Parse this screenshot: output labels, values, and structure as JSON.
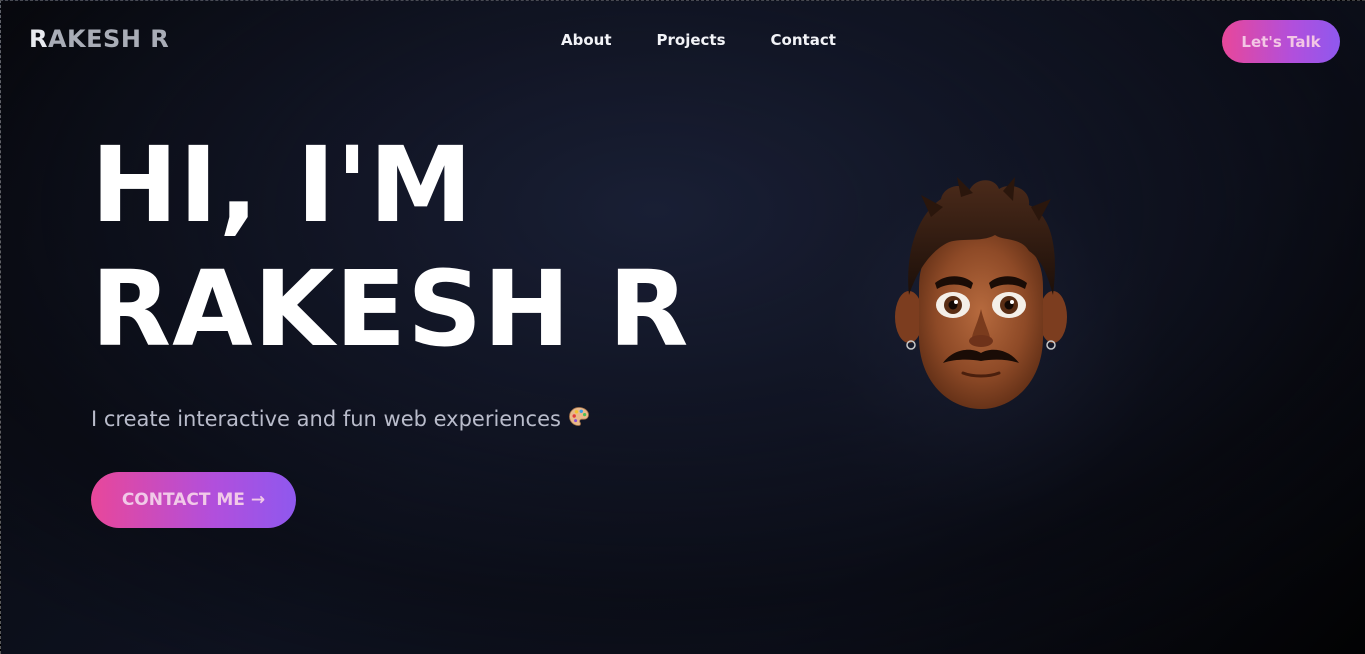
{
  "nav": {
    "brand_first": "R",
    "brand_rest": "AKESH R",
    "links": [
      {
        "label": "About"
      },
      {
        "label": "Projects"
      },
      {
        "label": "Contact"
      }
    ],
    "cta_label": "Let's Talk"
  },
  "hero": {
    "line1": "HI, I'M",
    "line2": "RAKESH R",
    "subtitle": "I create interactive and fun web experiences",
    "subtitle_emoji": "palette-icon",
    "button_label": "CONTACT ME",
    "button_arrow": "→"
  },
  "avatar": {
    "icon": "avatar-cartoon-face"
  },
  "colors": {
    "accent_start": "#e8479a",
    "accent_end": "#8f58ee",
    "background": "#0c0f1b",
    "text_primary": "#ffffff",
    "text_muted": "#b9bccb"
  }
}
